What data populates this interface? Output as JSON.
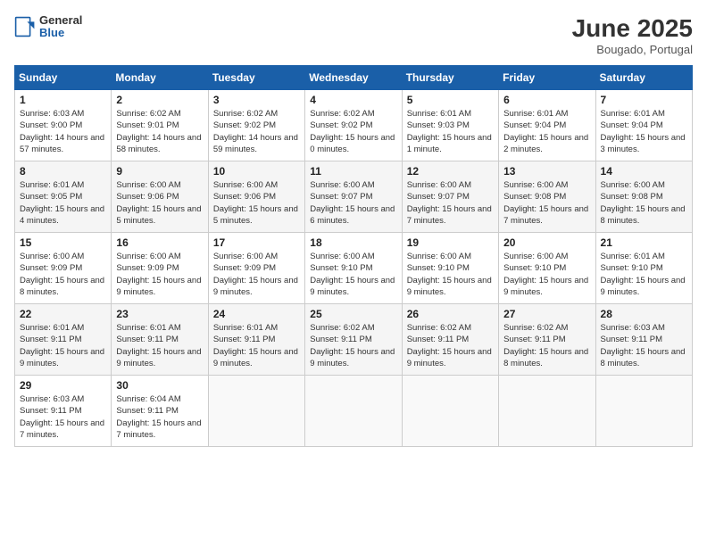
{
  "header": {
    "logo": {
      "line1": "General",
      "line2": "Blue"
    },
    "title": "June 2025",
    "location": "Bougado, Portugal"
  },
  "calendar": {
    "weekdays": [
      "Sunday",
      "Monday",
      "Tuesday",
      "Wednesday",
      "Thursday",
      "Friday",
      "Saturday"
    ],
    "weeks": [
      [
        {
          "day": "",
          "info": ""
        },
        {
          "day": "2",
          "info": "Sunrise: 6:02 AM\nSunset: 9:01 PM\nDaylight: 14 hours\nand 58 minutes."
        },
        {
          "day": "3",
          "info": "Sunrise: 6:02 AM\nSunset: 9:02 PM\nDaylight: 14 hours\nand 59 minutes."
        },
        {
          "day": "4",
          "info": "Sunrise: 6:02 AM\nSunset: 9:02 PM\nDaylight: 15 hours\nand 0 minutes."
        },
        {
          "day": "5",
          "info": "Sunrise: 6:01 AM\nSunset: 9:03 PM\nDaylight: 15 hours\nand 1 minute."
        },
        {
          "day": "6",
          "info": "Sunrise: 6:01 AM\nSunset: 9:04 PM\nDaylight: 15 hours\nand 2 minutes."
        },
        {
          "day": "7",
          "info": "Sunrise: 6:01 AM\nSunset: 9:04 PM\nDaylight: 15 hours\nand 3 minutes."
        }
      ],
      [
        {
          "day": "8",
          "info": "Sunrise: 6:01 AM\nSunset: 9:05 PM\nDaylight: 15 hours\nand 4 minutes."
        },
        {
          "day": "9",
          "info": "Sunrise: 6:00 AM\nSunset: 9:06 PM\nDaylight: 15 hours\nand 5 minutes."
        },
        {
          "day": "10",
          "info": "Sunrise: 6:00 AM\nSunset: 9:06 PM\nDaylight: 15 hours\nand 5 minutes."
        },
        {
          "day": "11",
          "info": "Sunrise: 6:00 AM\nSunset: 9:07 PM\nDaylight: 15 hours\nand 6 minutes."
        },
        {
          "day": "12",
          "info": "Sunrise: 6:00 AM\nSunset: 9:07 PM\nDaylight: 15 hours\nand 7 minutes."
        },
        {
          "day": "13",
          "info": "Sunrise: 6:00 AM\nSunset: 9:08 PM\nDaylight: 15 hours\nand 7 minutes."
        },
        {
          "day": "14",
          "info": "Sunrise: 6:00 AM\nSunset: 9:08 PM\nDaylight: 15 hours\nand 8 minutes."
        }
      ],
      [
        {
          "day": "15",
          "info": "Sunrise: 6:00 AM\nSunset: 9:09 PM\nDaylight: 15 hours\nand 8 minutes."
        },
        {
          "day": "16",
          "info": "Sunrise: 6:00 AM\nSunset: 9:09 PM\nDaylight: 15 hours\nand 9 minutes."
        },
        {
          "day": "17",
          "info": "Sunrise: 6:00 AM\nSunset: 9:09 PM\nDaylight: 15 hours\nand 9 minutes."
        },
        {
          "day": "18",
          "info": "Sunrise: 6:00 AM\nSunset: 9:10 PM\nDaylight: 15 hours\nand 9 minutes."
        },
        {
          "day": "19",
          "info": "Sunrise: 6:00 AM\nSunset: 9:10 PM\nDaylight: 15 hours\nand 9 minutes."
        },
        {
          "day": "20",
          "info": "Sunrise: 6:00 AM\nSunset: 9:10 PM\nDaylight: 15 hours\nand 9 minutes."
        },
        {
          "day": "21",
          "info": "Sunrise: 6:01 AM\nSunset: 9:10 PM\nDaylight: 15 hours\nand 9 minutes."
        }
      ],
      [
        {
          "day": "22",
          "info": "Sunrise: 6:01 AM\nSunset: 9:11 PM\nDaylight: 15 hours\nand 9 minutes."
        },
        {
          "day": "23",
          "info": "Sunrise: 6:01 AM\nSunset: 9:11 PM\nDaylight: 15 hours\nand 9 minutes."
        },
        {
          "day": "24",
          "info": "Sunrise: 6:01 AM\nSunset: 9:11 PM\nDaylight: 15 hours\nand 9 minutes."
        },
        {
          "day": "25",
          "info": "Sunrise: 6:02 AM\nSunset: 9:11 PM\nDaylight: 15 hours\nand 9 minutes."
        },
        {
          "day": "26",
          "info": "Sunrise: 6:02 AM\nSunset: 9:11 PM\nDaylight: 15 hours\nand 9 minutes."
        },
        {
          "day": "27",
          "info": "Sunrise: 6:02 AM\nSunset: 9:11 PM\nDaylight: 15 hours\nand 8 minutes."
        },
        {
          "day": "28",
          "info": "Sunrise: 6:03 AM\nSunset: 9:11 PM\nDaylight: 15 hours\nand 8 minutes."
        }
      ],
      [
        {
          "day": "29",
          "info": "Sunrise: 6:03 AM\nSunset: 9:11 PM\nDaylight: 15 hours\nand 7 minutes."
        },
        {
          "day": "30",
          "info": "Sunrise: 6:04 AM\nSunset: 9:11 PM\nDaylight: 15 hours\nand 7 minutes."
        },
        {
          "day": "",
          "info": ""
        },
        {
          "day": "",
          "info": ""
        },
        {
          "day": "",
          "info": ""
        },
        {
          "day": "",
          "info": ""
        },
        {
          "day": "",
          "info": ""
        }
      ]
    ],
    "week1_day1": {
      "day": "1",
      "info": "Sunrise: 6:03 AM\nSunset: 9:00 PM\nDaylight: 14 hours\nand 57 minutes."
    }
  }
}
